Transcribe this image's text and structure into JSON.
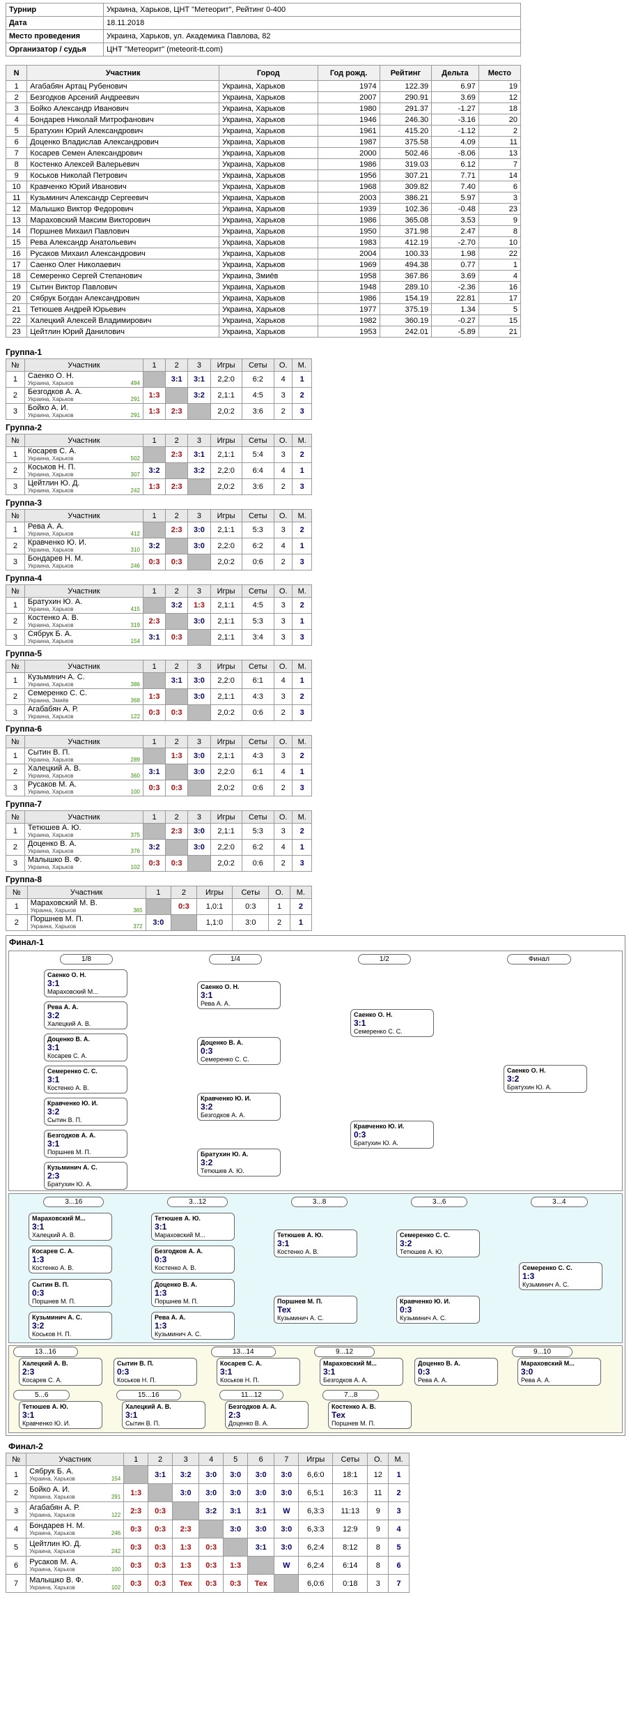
{
  "info": [
    {
      "k": "Турнир",
      "v": "Украина, Харьков, ЦНТ \"Метеорит\", Рейтинг 0-400"
    },
    {
      "k": "Дата",
      "v": "18.11.2018"
    },
    {
      "k": "Место проведения",
      "v": "Украина, Харьков, ул. Академика Павлова, 82"
    },
    {
      "k": "Организатор / судья",
      "v": "ЦНТ \"Метеорит\" (meteorit-tt.com)"
    }
  ],
  "participants_header": [
    "N",
    "Участник",
    "Город",
    "Год рожд.",
    "Рейтинг",
    "Дельта",
    "Место"
  ],
  "participants": [
    [
      "1",
      "Агабабян Артац Рубенович",
      "Украина, Харьков",
      "1974",
      "122.39",
      "6.97",
      "19"
    ],
    [
      "2",
      "Безгодков Арсений Андреевич",
      "Украина, Харьков",
      "2007",
      "290.91",
      "3.69",
      "12"
    ],
    [
      "3",
      "Бойко Александр Иванович",
      "Украина, Харьков",
      "1980",
      "291.37",
      "-1.27",
      "18"
    ],
    [
      "4",
      "Бондарев Николай Митрофанович",
      "Украина, Харьков",
      "1946",
      "246.30",
      "-3.16",
      "20"
    ],
    [
      "5",
      "Братухин Юрий Александрович",
      "Украина, Харьков",
      "1961",
      "415.20",
      "-1.12",
      "2"
    ],
    [
      "6",
      "Доценко Владислав Александрович",
      "Украина, Харьков",
      "1987",
      "375.58",
      "4.09",
      "11"
    ],
    [
      "7",
      "Косарев Семен Александрович",
      "Украина, Харьков",
      "2000",
      "502.46",
      "-8.06",
      "13"
    ],
    [
      "8",
      "Костенко Алексей Валерьевич",
      "Украина, Харьков",
      "1986",
      "319.03",
      "6.12",
      "7"
    ],
    [
      "9",
      "Коськов Николай Петрович",
      "Украина, Харьков",
      "1956",
      "307.21",
      "7.71",
      "14"
    ],
    [
      "10",
      "Кравченко Юрий Иванович",
      "Украина, Харьков",
      "1968",
      "309.82",
      "7.40",
      "6"
    ],
    [
      "11",
      "Кузьминич Александр Сергеевич",
      "Украина, Харьков",
      "2003",
      "386.21",
      "5.97",
      "3"
    ],
    [
      "12",
      "Малышко Виктор Федорович",
      "Украина, Харьков",
      "1939",
      "102.36",
      "-0.48",
      "23"
    ],
    [
      "13",
      "Мараховский Максим Викторович",
      "Украина, Харьков",
      "1986",
      "365.08",
      "3.53",
      "9"
    ],
    [
      "14",
      "Поршнев Михаил Павлович",
      "Украина, Харьков",
      "1950",
      "371.98",
      "2.47",
      "8"
    ],
    [
      "15",
      "Рева Александр Анатольевич",
      "Украина, Харьков",
      "1983",
      "412.19",
      "-2.70",
      "10"
    ],
    [
      "16",
      "Русаков Михаил Александрович",
      "Украина, Харьков",
      "2004",
      "100.33",
      "1.98",
      "22"
    ],
    [
      "17",
      "Саенко Олег Николаевич",
      "Украина, Харьков",
      "1969",
      "494.38",
      "0.77",
      "1"
    ],
    [
      "18",
      "Семеренко Сергей Степанович",
      "Украина, Змиёв",
      "1958",
      "367.86",
      "3.69",
      "4"
    ],
    [
      "19",
      "Сытин Виктор Павлович",
      "Украина, Харьков",
      "1948",
      "289.10",
      "-2.36",
      "16"
    ],
    [
      "20",
      "Сябрук Богдан Александрович",
      "Украина, Харьков",
      "1986",
      "154.19",
      "22.81",
      "17"
    ],
    [
      "21",
      "Тетюшев Андрей Юрьевич",
      "Украина, Харьков",
      "1977",
      "375.19",
      "1.34",
      "5"
    ],
    [
      "22",
      "Халецкий Алексей Владимирович",
      "Украина, Харьков",
      "1982",
      "360.19",
      "-0.27",
      "15"
    ],
    [
      "23",
      "Цейтлин Юрий Данилович",
      "Украина, Харьков",
      "1953",
      "242.01",
      "-5.89",
      "21"
    ]
  ],
  "group_header": [
    "№",
    "Участник",
    "1",
    "2",
    "3",
    "Игры",
    "Сеты",
    "О.",
    "М."
  ],
  "groups": [
    {
      "title": "Группа-1",
      "rows": [
        {
          "n": "1",
          "name": "Саенко О. Н.",
          "city": "Украина, Харьков",
          "r": "494",
          "s": [
            "",
            "3:1",
            "3:1"
          ],
          "g": "2,2:0",
          "sets": "6:2",
          "o": "4",
          "m": "1"
        },
        {
          "n": "2",
          "name": "Безгодков А. А.",
          "city": "Украина, Харьков",
          "r": "291",
          "s": [
            "1:3",
            "",
            "3:2"
          ],
          "g": "2,1:1",
          "sets": "4:5",
          "o": "3",
          "m": "2"
        },
        {
          "n": "3",
          "name": "Бойко А. И.",
          "city": "Украина, Харьков",
          "r": "291",
          "s": [
            "1:3",
            "2:3",
            ""
          ],
          "g": "2,0:2",
          "sets": "3:6",
          "o": "2",
          "m": "3"
        }
      ]
    },
    {
      "title": "Группа-2",
      "rows": [
        {
          "n": "1",
          "name": "Косарев С. А.",
          "city": "Украина, Харьков",
          "r": "502",
          "s": [
            "",
            "2:3",
            "3:1"
          ],
          "g": "2,1:1",
          "sets": "5:4",
          "o": "3",
          "m": "2"
        },
        {
          "n": "2",
          "name": "Коськов Н. П.",
          "city": "Украина, Харьков",
          "r": "307",
          "s": [
            "3:2",
            "",
            "3:2"
          ],
          "g": "2,2:0",
          "sets": "6:4",
          "o": "4",
          "m": "1"
        },
        {
          "n": "3",
          "name": "Цейтлин Ю. Д.",
          "city": "Украина, Харьков",
          "r": "242",
          "s": [
            "1:3",
            "2:3",
            ""
          ],
          "g": "2,0:2",
          "sets": "3:6",
          "o": "2",
          "m": "3"
        }
      ]
    },
    {
      "title": "Группа-3",
      "rows": [
        {
          "n": "1",
          "name": "Рева А. А.",
          "city": "Украина, Харьков",
          "r": "412",
          "s": [
            "",
            "2:3",
            "3:0"
          ],
          "g": "2,1:1",
          "sets": "5:3",
          "o": "3",
          "m": "2"
        },
        {
          "n": "2",
          "name": "Кравченко Ю. И.",
          "city": "Украина, Харьков",
          "r": "310",
          "s": [
            "3:2",
            "",
            "3:0"
          ],
          "g": "2,2:0",
          "sets": "6:2",
          "o": "4",
          "m": "1"
        },
        {
          "n": "3",
          "name": "Бондарев Н. М.",
          "city": "Украина, Харьков",
          "r": "246",
          "s": [
            "0:3",
            "0:3",
            ""
          ],
          "g": "2,0:2",
          "sets": "0:6",
          "o": "2",
          "m": "3"
        }
      ]
    },
    {
      "title": "Группа-4",
      "rows": [
        {
          "n": "1",
          "name": "Братухин Ю. А.",
          "city": "Украина, Харьков",
          "r": "415",
          "s": [
            "",
            "3:2",
            "1:3"
          ],
          "g": "2,1:1",
          "sets": "4:5",
          "o": "3",
          "m": "2"
        },
        {
          "n": "2",
          "name": "Костенко А. В.",
          "city": "Украина, Харьков",
          "r": "319",
          "s": [
            "2:3",
            "",
            "3:0"
          ],
          "g": "2,1:1",
          "sets": "5:3",
          "o": "3",
          "m": "1"
        },
        {
          "n": "3",
          "name": "Сябрук Б. А.",
          "city": "Украина, Харьков",
          "r": "154",
          "s": [
            "3:1",
            "0:3",
            ""
          ],
          "g": "2,1:1",
          "sets": "3:4",
          "o": "3",
          "m": "3"
        }
      ]
    },
    {
      "title": "Группа-5",
      "rows": [
        {
          "n": "1",
          "name": "Кузьминич А. С.",
          "city": "Украина, Харьков",
          "r": "386",
          "s": [
            "",
            "3:1",
            "3:0"
          ],
          "g": "2,2:0",
          "sets": "6:1",
          "o": "4",
          "m": "1"
        },
        {
          "n": "2",
          "name": "Семеренко С. С.",
          "city": "Украина, Змиёв",
          "r": "368",
          "s": [
            "1:3",
            "",
            "3:0"
          ],
          "g": "2,1:1",
          "sets": "4:3",
          "o": "3",
          "m": "2"
        },
        {
          "n": "3",
          "name": "Агабабян А. Р.",
          "city": "Украина, Харьков",
          "r": "122",
          "s": [
            "0:3",
            "0:3",
            ""
          ],
          "g": "2,0:2",
          "sets": "0:6",
          "o": "2",
          "m": "3"
        }
      ]
    },
    {
      "title": "Группа-6",
      "rows": [
        {
          "n": "1",
          "name": "Сытин В. П.",
          "city": "Украина, Харьков",
          "r": "289",
          "s": [
            "",
            "1:3",
            "3:0"
          ],
          "g": "2,1:1",
          "sets": "4:3",
          "o": "3",
          "m": "2"
        },
        {
          "n": "2",
          "name": "Халецкий А. В.",
          "city": "Украина, Харьков",
          "r": "360",
          "s": [
            "3:1",
            "",
            "3:0"
          ],
          "g": "2,2:0",
          "sets": "6:1",
          "o": "4",
          "m": "1"
        },
        {
          "n": "3",
          "name": "Русаков М. А.",
          "city": "Украина, Харьков",
          "r": "100",
          "s": [
            "0:3",
            "0:3",
            ""
          ],
          "g": "2,0:2",
          "sets": "0:6",
          "o": "2",
          "m": "3"
        }
      ]
    },
    {
      "title": "Группа-7",
      "rows": [
        {
          "n": "1",
          "name": "Тетюшев А. Ю.",
          "city": "Украина, Харьков",
          "r": "375",
          "s": [
            "",
            "2:3",
            "3:0"
          ],
          "g": "2,1:1",
          "sets": "5:3",
          "o": "3",
          "m": "2"
        },
        {
          "n": "2",
          "name": "Доценко В. А.",
          "city": "Украина, Харьков",
          "r": "376",
          "s": [
            "3:2",
            "",
            "3:0"
          ],
          "g": "2,2:0",
          "sets": "6:2",
          "o": "4",
          "m": "1"
        },
        {
          "n": "3",
          "name": "Малышко В. Ф.",
          "city": "Украина, Харьков",
          "r": "102",
          "s": [
            "0:3",
            "0:3",
            ""
          ],
          "g": "2,0:2",
          "sets": "0:6",
          "o": "2",
          "m": "3"
        }
      ]
    },
    {
      "title": "Группа-8",
      "header": [
        "№",
        "Участник",
        "1",
        "2",
        "Игры",
        "Сеты",
        "О.",
        "М."
      ],
      "rows": [
        {
          "n": "1",
          "name": "Мараховский М. В.",
          "city": "Украина, Харьков",
          "r": "365",
          "s": [
            "",
            "0:3"
          ],
          "g": "1,0:1",
          "sets": "0:3",
          "o": "1",
          "m": "2"
        },
        {
          "n": "2",
          "name": "Поршнев М. П.",
          "city": "Украина, Харьков",
          "r": "372",
          "s": [
            "3:0",
            ""
          ],
          "g": "1,1:0",
          "sets": "3:0",
          "o": "2",
          "m": "1"
        }
      ]
    }
  ],
  "final1": {
    "title": "Финал-1",
    "rounds": [
      "1/8",
      "1/4",
      "1/2",
      "Финал"
    ],
    "r1": [
      {
        "a": "Саенко О. Н.",
        "b": "Мараховский М...",
        "sc": "3:1"
      },
      {
        "a": "Рева А. А.",
        "b": "Халецкий А. В.",
        "sc": "3:2"
      },
      {
        "a": "Доценко В. А.",
        "b": "Косарев С. А.",
        "sc": "3:1"
      },
      {
        "a": "Семеренко С. С.",
        "b": "Костенко А. В.",
        "sc": "3:1"
      },
      {
        "a": "Кравченко Ю. И.",
        "b": "Сытин В. П.",
        "sc": "3:2"
      },
      {
        "a": "Безгодков А. А.",
        "b": "Поршнев М. П.",
        "sc": "3:1"
      },
      {
        "a": "Кузьминич А. С.",
        "b": "Братухин Ю. А.",
        "sc": "2:3"
      },
      {
        "a": "Тетюшев А. Ю.",
        "b": "Коськов Н. П.",
        "sc": "3:1"
      }
    ],
    "r2": [
      {
        "a": "Саенко О. Н.",
        "b": "Рева А. А.",
        "sc": "3:1"
      },
      {
        "a": "Доценко В. А.",
        "b": "Семеренко С. С.",
        "sc": "0:3"
      },
      {
        "a": "Кравченко Ю. И.",
        "b": "Безгодков А. А.",
        "sc": "3:2"
      },
      {
        "a": "Братухин Ю. А.",
        "b": "Тетюшев А. Ю.",
        "sc": "3:2"
      }
    ],
    "r3": [
      {
        "a": "Саенко О. Н.",
        "b": "Семеренко С. С.",
        "sc": "3:1"
      },
      {
        "a": "Кравченко Ю. И.",
        "b": "Братухин Ю. А.",
        "sc": "0:3"
      }
    ],
    "r4": [
      {
        "a": "Саенко О. Н.",
        "b": "Братухин Ю. А.",
        "sc": "3:2"
      }
    ]
  },
  "consol_rounds": [
    "3...16",
    "3...12",
    "3...8",
    "3...6",
    "3...4"
  ],
  "consol": [
    {
      "a": "Мараховский М...",
      "b": "Халецкий А. В.",
      "sc": "3:1"
    },
    {
      "a": "Косарев С. А.",
      "b": "Костенко А. В.",
      "sc": "1:3"
    },
    {
      "a": "Сытин В. П.",
      "b": "Поршнев М. П.",
      "sc": "0:3"
    },
    {
      "a": "Кузьминич А. С.",
      "b": "Коськов Н. П.",
      "sc": "3:2"
    },
    {
      "a": "Тетюшев А. Ю.",
      "b": "Мараховский М...",
      "sc": "3:1"
    },
    {
      "a": "Безгодков А. А.",
      "b": "Костенко А. В.",
      "sc": "0:3"
    },
    {
      "a": "Доценко В. А.",
      "b": "Поршнев М. П.",
      "sc": "1:3"
    },
    {
      "a": "Рева А. А.",
      "b": "Кузьминич А. С.",
      "sc": "1:3"
    },
    {
      "a": "Тетюшев А. Ю.",
      "b": "Костенко А. В.",
      "sc": "3:1"
    },
    {
      "a": "Поршнев М. П.",
      "b": "Кузьминич А. С.",
      "sc": "Тех"
    },
    {
      "a": "Семеренко С. С.",
      "b": "Тетюшев А. Ю.",
      "sc": "3:2"
    },
    {
      "a": "Кравченко Ю. И.",
      "b": "Кузьминич А. С.",
      "sc": "0:3"
    },
    {
      "a": "Семеренко С. С.",
      "b": "Кузьминич А. С.",
      "sc": "1:3"
    }
  ],
  "small": [
    {
      "title": "13...16",
      "m": [
        {
          "a": "Халецкий А. В.",
          "b": "Косарев С. А.",
          "sc": "2:3"
        },
        {
          "a": "Сытин В. П.",
          "b": "Коськов Н. П.",
          "sc": "0:3"
        }
      ]
    },
    {
      "title": "13...14",
      "m": [
        {
          "a": "Косарев С. А.",
          "b": "Коськов Н. П.",
          "sc": "3:1"
        }
      ]
    },
    {
      "title": "9...12",
      "m": [
        {
          "a": "Мараховский М...",
          "b": "Безгодков А. А.",
          "sc": "3:1"
        },
        {
          "a": "Доценко В. А.",
          "b": "Рева А. А.",
          "sc": "0:3"
        }
      ]
    },
    {
      "title": "9...10",
      "m": [
        {
          "a": "Мараховский М...",
          "b": "Рева А. А.",
          "sc": "3:0"
        }
      ]
    },
    {
      "title": "5...6",
      "m": [
        {
          "a": "Тетюшев А. Ю.",
          "b": "Кравченко Ю. И.",
          "sc": "3:1"
        }
      ]
    },
    {
      "title": "15...16",
      "m": [
        {
          "a": "Халецкий А. В.",
          "b": "Сытин В. П.",
          "sc": "3:1"
        }
      ]
    },
    {
      "title": "11...12",
      "m": [
        {
          "a": "Безгодков А. А.",
          "b": "Доценко В. А.",
          "sc": "2:3"
        }
      ]
    },
    {
      "title": "7...8",
      "m": [
        {
          "a": "Костенко А. В.",
          "b": "Поршнев М. П.",
          "sc": "Тех"
        }
      ]
    }
  ],
  "final2": {
    "title": "Финал-2",
    "header": [
      "№",
      "Участник",
      "1",
      "2",
      "3",
      "4",
      "5",
      "6",
      "7",
      "Игры",
      "Сеты",
      "О.",
      "М."
    ],
    "rows": [
      {
        "n": "1",
        "name": "Сябрук Б. А.",
        "r": "154",
        "s": [
          "",
          "3:1",
          "3:2",
          "3:0",
          "3:0",
          "3:0",
          "3:0"
        ],
        "g": "6,6:0",
        "sets": "18:1",
        "o": "12",
        "m": "1"
      },
      {
        "n": "2",
        "name": "Бойко А. И.",
        "r": "291",
        "s": [
          "1:3",
          "",
          "3:0",
          "3:0",
          "3:0",
          "3:0",
          "3:0"
        ],
        "g": "6,5:1",
        "sets": "16:3",
        "o": "11",
        "m": "2"
      },
      {
        "n": "3",
        "name": "Агабабян А. Р.",
        "r": "122",
        "s": [
          "2:3",
          "0:3",
          "",
          "3:2",
          "3:1",
          "3:1",
          "W"
        ],
        "g": "6,3:3",
        "sets": "11:13",
        "o": "9",
        "m": "3"
      },
      {
        "n": "4",
        "name": "Бондарев Н. М.",
        "r": "246",
        "s": [
          "0:3",
          "0:3",
          "2:3",
          "",
          "3:0",
          "3:0",
          "3:0"
        ],
        "g": "6,3:3",
        "sets": "12:9",
        "o": "9",
        "m": "4"
      },
      {
        "n": "5",
        "name": "Цейтлин Ю. Д.",
        "r": "242",
        "s": [
          "0:3",
          "0:3",
          "1:3",
          "0:3",
          "",
          "3:1",
          "3:0"
        ],
        "g": "6,2:4",
        "sets": "8:12",
        "o": "8",
        "m": "5"
      },
      {
        "n": "6",
        "name": "Русаков М. А.",
        "r": "100",
        "s": [
          "0:3",
          "0:3",
          "1:3",
          "0:3",
          "1:3",
          "",
          "W"
        ],
        "g": "6,2:4",
        "sets": "6:14",
        "o": "8",
        "m": "6"
      },
      {
        "n": "7",
        "name": "Малышко В. Ф.",
        "r": "102",
        "s": [
          "0:3",
          "0:3",
          "Тех",
          "0:3",
          "0:3",
          "Тех",
          ""
        ],
        "g": "6,0:6",
        "sets": "0:18",
        "o": "3",
        "m": "7"
      }
    ]
  }
}
